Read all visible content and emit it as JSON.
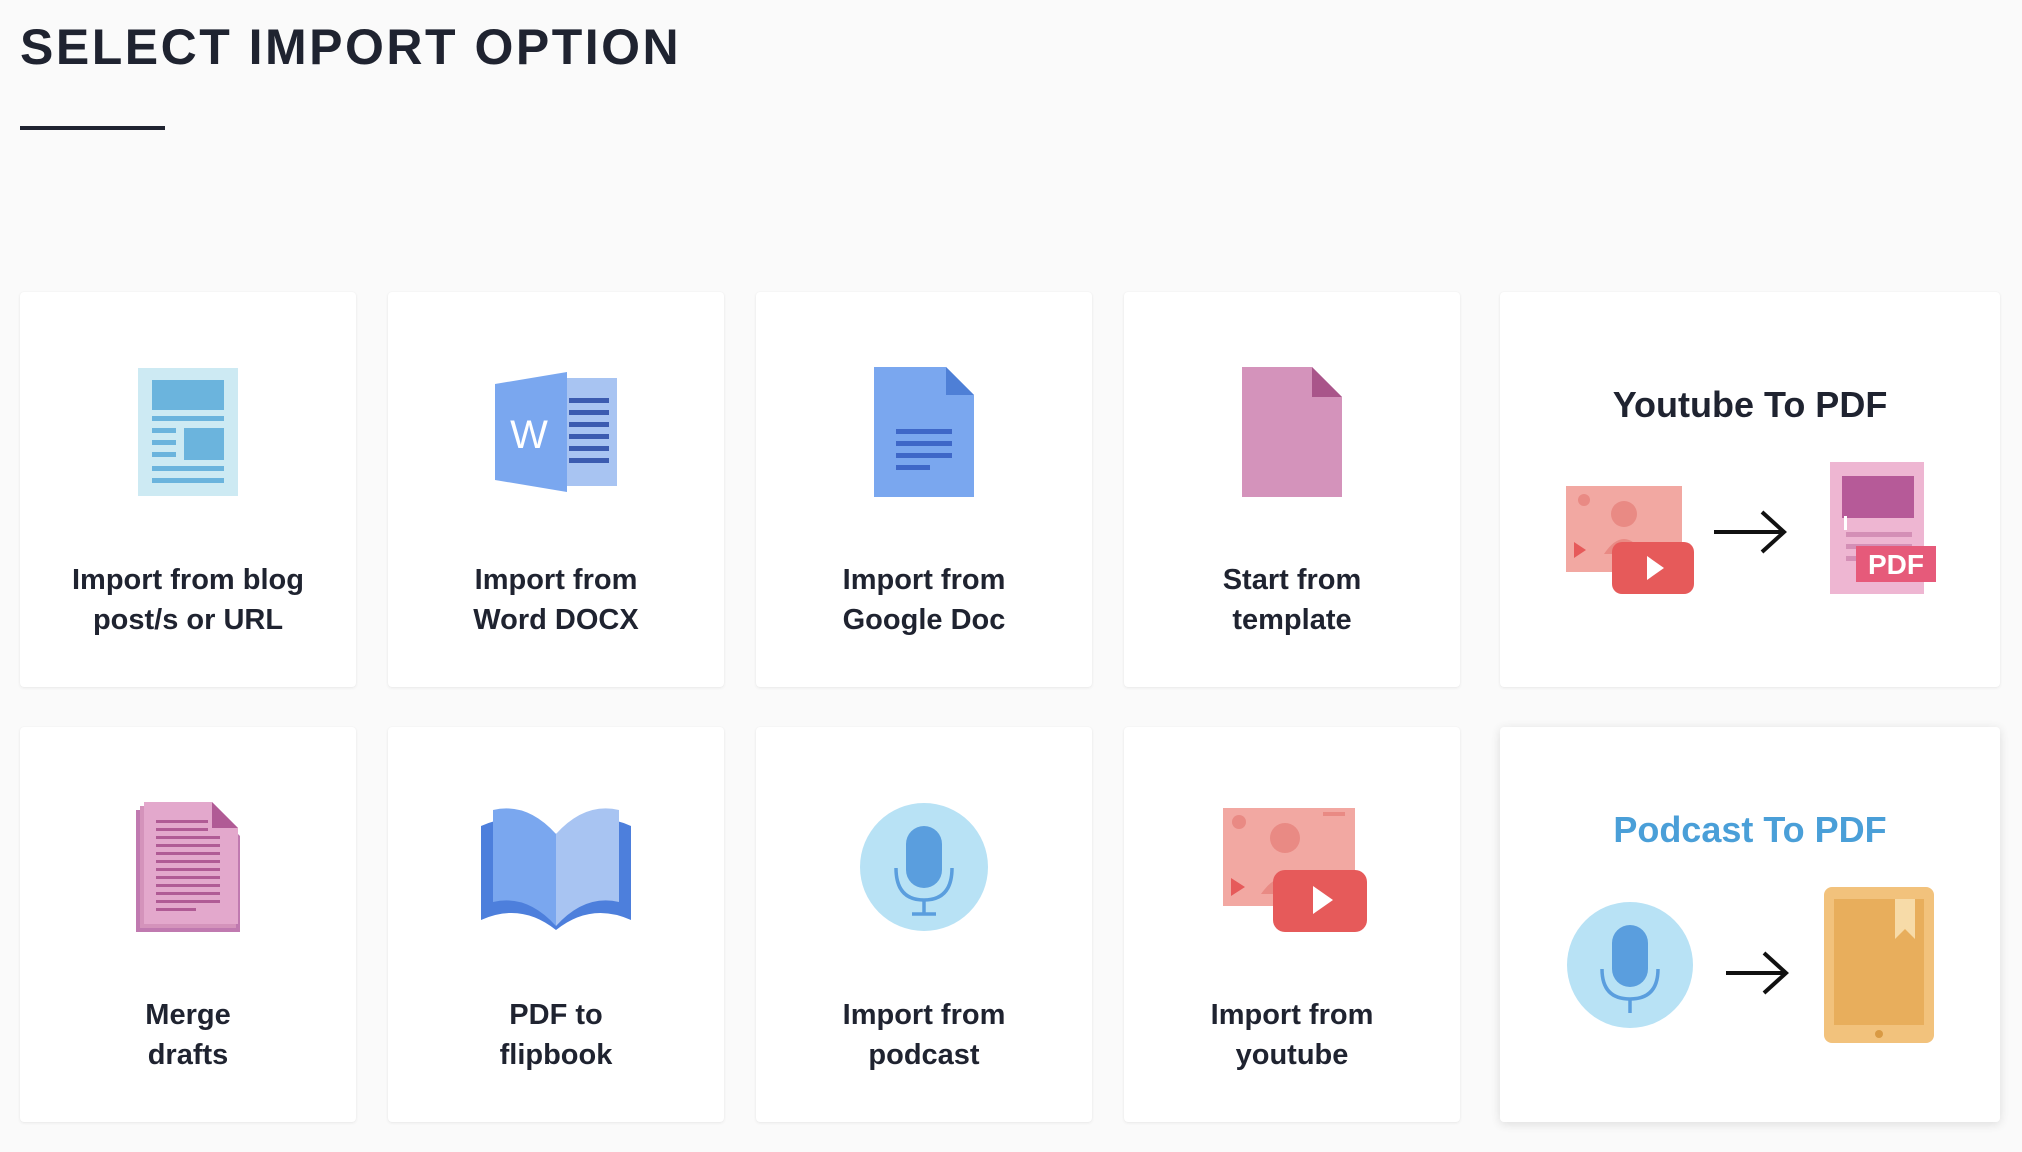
{
  "page": {
    "title": "SELECT IMPORT OPTION"
  },
  "cards": [
    {
      "name": "import-blog-url",
      "icon": "blog-page-icon",
      "label_line1": "Import from blog",
      "label_line2": "post/s or URL"
    },
    {
      "name": "import-word-docx",
      "icon": "word-doc-icon",
      "label_line1": "Import from",
      "label_line2": "Word DOCX"
    },
    {
      "name": "import-google-doc",
      "icon": "google-doc-icon",
      "label_line1": "Import from",
      "label_line2": "Google Doc"
    },
    {
      "name": "start-from-template",
      "icon": "template-doc-icon",
      "label_line1": "Start from",
      "label_line2": "template"
    },
    {
      "name": "merge-drafts",
      "icon": "stacked-docs-icon",
      "label_line1": "Merge",
      "label_line2": "drafts"
    },
    {
      "name": "pdf-to-flipbook",
      "icon": "open-book-icon",
      "label_line1": "PDF to",
      "label_line2": "flipbook"
    },
    {
      "name": "import-podcast",
      "icon": "microphone-icon",
      "label_line1": "Import from",
      "label_line2": "podcast"
    },
    {
      "name": "import-youtube",
      "icon": "video-play-icon",
      "label_line1": "Import from",
      "label_line2": "youtube"
    }
  ],
  "promos": {
    "youtube_to_pdf": {
      "title": "Youtube To PDF",
      "pdf_badge": "PDF",
      "title_color": "#1f2330"
    },
    "podcast_to_pdf": {
      "title": "Podcast To PDF",
      "title_color": "#4a9fd8"
    }
  },
  "colors": {
    "blue_icon": "#7aa7ef",
    "pink_icon": "#d493bb",
    "red_video": "#e65a5a",
    "mic_circle": "#b8e2f5",
    "tablet_orange": "#e8ae5c"
  }
}
